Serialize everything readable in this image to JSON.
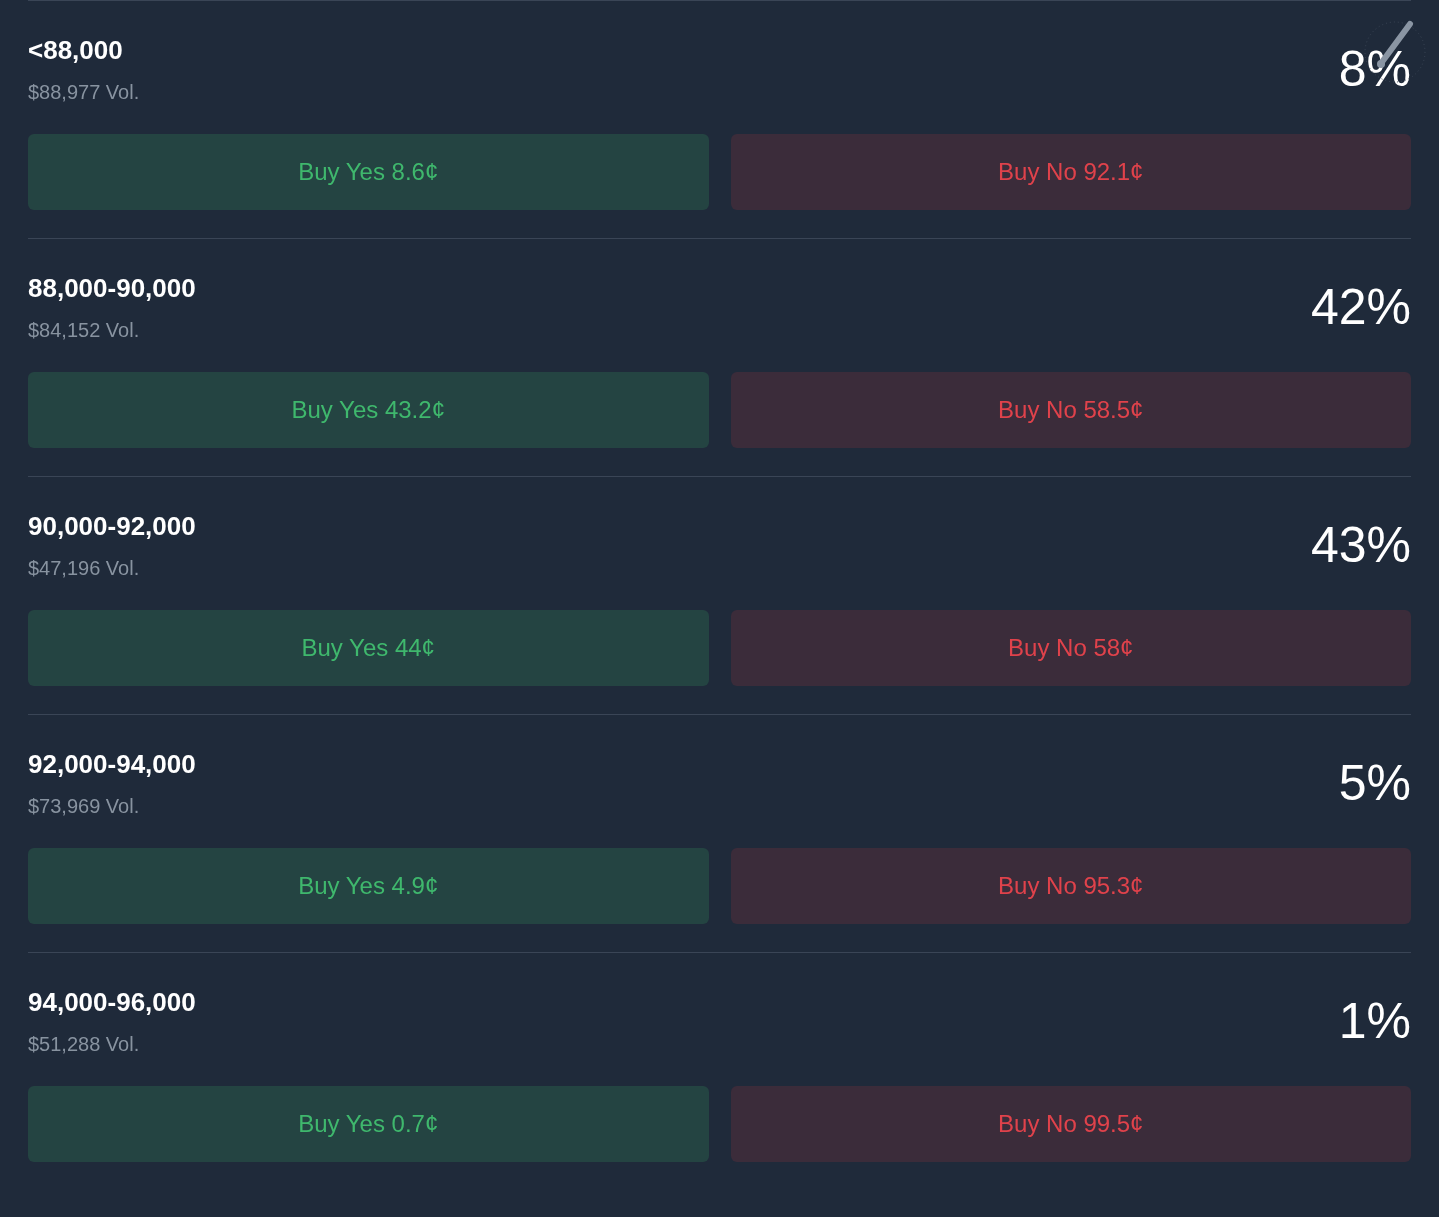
{
  "outcomes": [
    {
      "range": "<88,000",
      "volume": "$88,977 Vol.",
      "chance": "8%",
      "buy_yes": "Buy Yes 8.6¢",
      "buy_no": "Buy No 92.1¢"
    },
    {
      "range": "88,000-90,000",
      "volume": "$84,152 Vol.",
      "chance": "42%",
      "buy_yes": "Buy Yes 43.2¢",
      "buy_no": "Buy No 58.5¢"
    },
    {
      "range": "90,000-92,000",
      "volume": "$47,196 Vol.",
      "chance": "43%",
      "buy_yes": "Buy Yes 44¢",
      "buy_no": "Buy No 58¢"
    },
    {
      "range": "92,000-94,000",
      "volume": "$73,969 Vol.",
      "chance": "5%",
      "buy_yes": "Buy Yes 4.9¢",
      "buy_no": "Buy No 95.3¢"
    },
    {
      "range": "94,000-96,000",
      "volume": "$51,288 Vol.",
      "chance": "1%",
      "buy_yes": "Buy Yes 0.7¢",
      "buy_no": "Buy No 99.5¢"
    }
  ]
}
